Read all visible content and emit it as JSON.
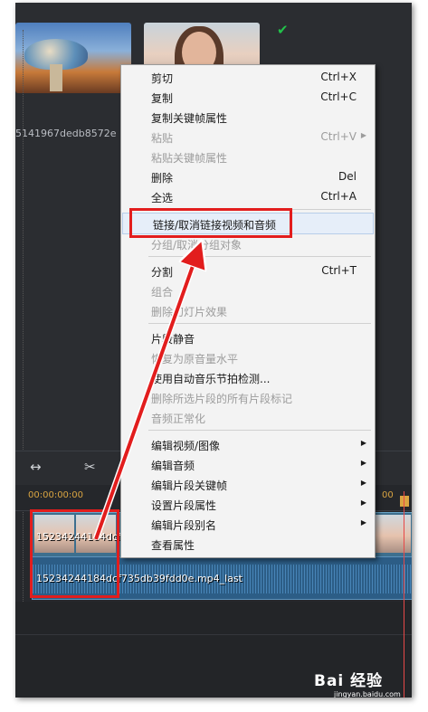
{
  "media": {
    "clip_name": "5141967dedb8572e"
  },
  "timeline": {
    "ruler_start": "00:00:00:00",
    "ruler_end": "00",
    "video_clip_label": "15234244184dcf",
    "audio_clip_label": "15234244184dcf735db39fdd0e.mp4_last"
  },
  "menu": {
    "items": [
      {
        "label": "剪切",
        "shortcut": "Ctrl+X",
        "enabled": true
      },
      {
        "label": "复制",
        "shortcut": "Ctrl+C",
        "enabled": true
      },
      {
        "label": "复制关键帧属性",
        "shortcut": "",
        "enabled": true
      },
      {
        "label": "粘贴",
        "shortcut": "Ctrl+V",
        "enabled": false,
        "submenu": true
      },
      {
        "label": "粘贴关键帧属性",
        "shortcut": "",
        "enabled": false
      },
      {
        "label": "删除",
        "shortcut": "Del",
        "enabled": true
      },
      {
        "label": "全选",
        "shortcut": "Ctrl+A",
        "enabled": true
      },
      {
        "label": "链接/取消链接视频和音频",
        "shortcut": "",
        "enabled": true,
        "highlighted": true
      },
      {
        "label": "分组/取消分组对象",
        "shortcut": "",
        "enabled": false
      },
      {
        "label": "分割",
        "shortcut": "Ctrl+T",
        "enabled": true
      },
      {
        "label": "组合",
        "shortcut": "",
        "enabled": false
      },
      {
        "label": "删除幻灯片效果",
        "shortcut": "",
        "enabled": false
      },
      {
        "label": "片段静音",
        "shortcut": "",
        "enabled": true
      },
      {
        "label": "恢复为原音量水平",
        "shortcut": "",
        "enabled": false
      },
      {
        "label": "使用自动音乐节拍检测...",
        "shortcut": "",
        "enabled": true
      },
      {
        "label": "删除所选片段的所有片段标记",
        "shortcut": "",
        "enabled": false
      },
      {
        "label": "音频正常化",
        "shortcut": "",
        "enabled": false
      },
      {
        "label": "编辑视频/图像",
        "shortcut": "",
        "enabled": true,
        "submenu": true
      },
      {
        "label": "编辑音频",
        "shortcut": "",
        "enabled": true,
        "submenu": true
      },
      {
        "label": "编辑片段关键帧",
        "shortcut": "",
        "enabled": true,
        "submenu": true
      },
      {
        "label": "设置片段属性",
        "shortcut": "",
        "enabled": true,
        "submenu": true
      },
      {
        "label": "编辑片段别名",
        "shortcut": "",
        "enabled": true,
        "submenu": true
      },
      {
        "label": "查看属性",
        "shortcut": "",
        "enabled": true
      }
    ]
  },
  "watermark": {
    "brand": "Bai 经验",
    "url": "jingyan.baidu.com"
  },
  "colors": {
    "annotation": "#e21d1d",
    "ruler_time": "#d9a441",
    "check": "#22c24a"
  }
}
